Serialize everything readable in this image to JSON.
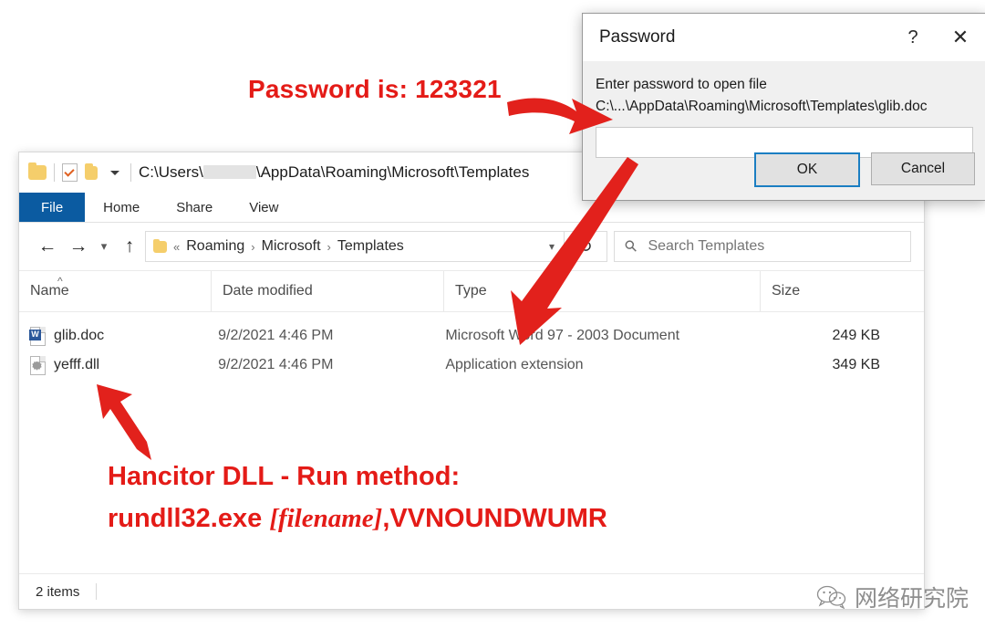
{
  "explorer": {
    "quick_access": {
      "folder_icon": "folder-icon",
      "properties_icon": "properties-icon",
      "new_folder_icon": "new-folder-icon",
      "customize_caret": "chevron-down-icon"
    },
    "title_path_prefix": "C:\\Users\\",
    "title_path_suffix": "\\AppData\\Roaming\\Microsoft\\Templates",
    "ribbon_tabs": [
      {
        "label": "File",
        "active": true
      },
      {
        "label": "Home",
        "active": false
      },
      {
        "label": "Share",
        "active": false
      },
      {
        "label": "View",
        "active": false
      }
    ],
    "nav": {
      "back_icon": "arrow-left-icon",
      "forward_icon": "arrow-right-icon",
      "recent_icon": "chevron-down-icon",
      "up_icon": "arrow-up-icon"
    },
    "breadcrumb": {
      "overflow": "«",
      "items": [
        "Roaming",
        "Microsoft",
        "Templates"
      ],
      "separator": "›",
      "dropdown_icon": "chevron-down-icon"
    },
    "refresh_icon": "refresh-icon",
    "search": {
      "icon": "search-icon",
      "placeholder": "Search Templates",
      "value": ""
    },
    "columns": [
      {
        "label": "Name",
        "sorted": true,
        "sort_icon": "chevron-up-icon"
      },
      {
        "label": "Date modified",
        "sorted": false
      },
      {
        "label": "Type",
        "sorted": false
      },
      {
        "label": "Size",
        "sorted": false
      }
    ],
    "files": [
      {
        "icon": "word-document-icon",
        "name": "glib.doc",
        "date_modified": "9/2/2021 4:46 PM",
        "type": "Microsoft Word 97 - 2003 Document",
        "size": "249 KB"
      },
      {
        "icon": "dll-file-icon",
        "name": "yefff.dll",
        "date_modified": "9/2/2021 4:46 PM",
        "type": "Application extension",
        "size": "349 KB"
      }
    ],
    "status": {
      "item_count": "2 items"
    }
  },
  "password_dialog": {
    "title": "Password",
    "help_icon": "question-mark-icon",
    "close_icon": "close-icon",
    "prompt": "Enter password to open file",
    "file_path": "C:\\...\\AppData\\Roaming\\Microsoft\\Templates\\glib.doc",
    "input_value": "",
    "ok_label": "OK",
    "cancel_label": "Cancel"
  },
  "annotations": {
    "password_note": "Password is: 123321",
    "dll_line1": "Hancitor DLL - Run method:",
    "dll_line2_prefix": "rundll32.exe ",
    "dll_line2_italic": "[filename]",
    "dll_line2_suffix": ",VVNOUNDWUMR",
    "arrow_color": "#e2211c",
    "text_color": "#e41b17"
  },
  "watermark": {
    "icon": "wechat-icon",
    "text": "网络研究院"
  }
}
